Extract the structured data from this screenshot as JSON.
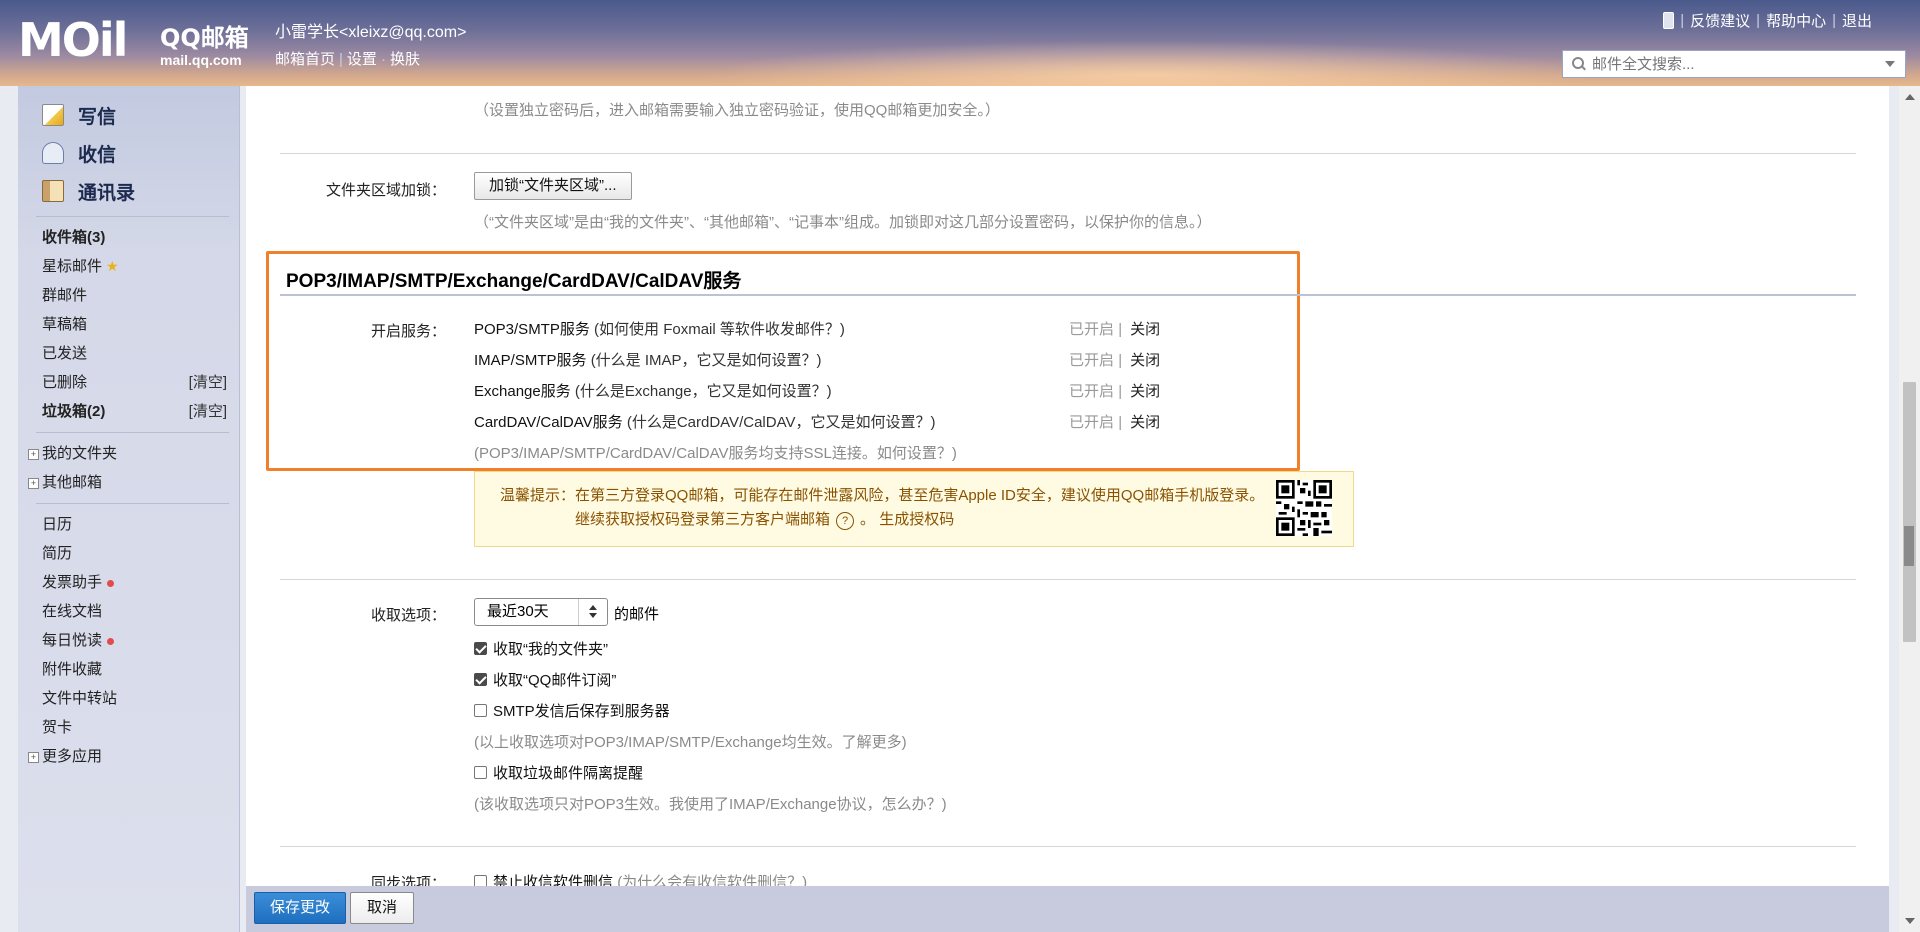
{
  "header": {
    "logo_text": "MOil",
    "qq_title": "QQ邮箱",
    "qq_domain": "mail.qq.com",
    "user_name": "小雷学长<xleixz@qq.com>",
    "links": [
      "邮箱首页",
      "设置",
      "换肤"
    ],
    "top_links": [
      "反馈建议",
      "帮助中心",
      "退出"
    ],
    "search_placeholder": "邮件全文搜索..."
  },
  "sidebar": {
    "actions": [
      {
        "label": "写信",
        "icon": "pencil-note-icon"
      },
      {
        "label": "收信",
        "icon": "inbox-icon"
      },
      {
        "label": "通讯录",
        "icon": "contacts-book-icon"
      }
    ],
    "folders": [
      {
        "label": "收件箱(3)",
        "bold": true
      },
      {
        "label": "星标邮件"
      },
      {
        "label": "群邮件"
      },
      {
        "label": "草稿箱"
      },
      {
        "label": "已发送"
      },
      {
        "label": "已删除",
        "right": "[清空]"
      },
      {
        "label": "垃圾箱(2)",
        "bold": true,
        "right": "[清空]"
      }
    ],
    "groups": [
      {
        "label": "我的文件夹"
      },
      {
        "label": "其他邮箱"
      }
    ],
    "apps": [
      "日历",
      "简历",
      "发票助手",
      "在线文档",
      "每日悦读",
      "附件收藏",
      "文件中转站",
      "贺卡"
    ],
    "more_apps": "更多应用"
  },
  "main": {
    "top_hint": "（设置独立密码后，进入邮箱需要输入独立密码验证，使用QQ邮箱更加安全。）",
    "folder_lock": {
      "label": "文件夹区域加锁：",
      "button": "加锁“文件夹区域”...",
      "hint": "（“文件夹区域”是由“我的文件夹”、“其他邮箱”、“记事本”组成。加锁即对这几部分设置密码，以保护你的信息。）"
    },
    "section_title": "POP3/IMAP/SMTP/Exchange/CardDAV/CalDAV服务",
    "services_label": "开启服务：",
    "services": [
      {
        "name": "POP3/SMTP服务",
        "help": "(如何使用 Foxmail 等软件收发邮件？)",
        "status": "已开启",
        "sep": "|",
        "action": "关闭"
      },
      {
        "name": "IMAP/SMTP服务",
        "help": "(什么是 IMAP，它又是如何设置？)",
        "status": "已开启",
        "sep": "|",
        "action": "关闭"
      },
      {
        "name": "Exchange服务",
        "help": "(什么是Exchange，它又是如何设置？)",
        "status": "已开启",
        "sep": "|",
        "action": "关闭"
      },
      {
        "name": "CardDAV/CalDAV服务",
        "help": "(什么是CardDAV/CalDAV，它又是如何设置？)",
        "status": "已开启",
        "sep": "|",
        "action": "关闭"
      }
    ],
    "ssl_hint": "(POP3/IMAP/SMTP/CardDAV/CalDAV服务均支持SSL连接。如何设置？)",
    "tip": {
      "line1": "温馨提示：在第三方登录QQ邮箱，可能存在邮件泄露风险，甚至危害Apple ID安全，建议使用QQ邮箱手机版登录。",
      "line2_prefix": "继续获取授权码登录第三方客户端邮箱",
      "qmark": "?",
      "line2_suffix": "。",
      "gen_link": "生成授权码"
    },
    "fetch": {
      "label": "收取选项：",
      "select_value": "最近30天",
      "select_suffix": "的邮件",
      "options": [
        {
          "label": "收取“我的文件夹”",
          "checked": true
        },
        {
          "label": "收取“QQ邮件订阅”",
          "checked": true
        },
        {
          "label": "SMTP发信后保存到服务器",
          "checked": false
        }
      ],
      "hint1": "(以上收取选项对POP3/IMAP/SMTP/Exchange均生效。了解更多)",
      "spam_option": "收取垃圾邮件隔离提醒",
      "hint2": "(该收取选项只对POP3生效。我使用了IMAP/Exchange协议，怎么办？)"
    },
    "sync": {
      "label": "同步选项：",
      "option": "禁止收信软件删信",
      "help": "(为什么会有收信软件删信？)"
    }
  },
  "bottom": {
    "save": "保存更改",
    "cancel": "取消"
  },
  "colors": {
    "highlight_border": "#f0802a",
    "save_button": "#1e6fc0",
    "tip_background": "#fffbe3"
  }
}
